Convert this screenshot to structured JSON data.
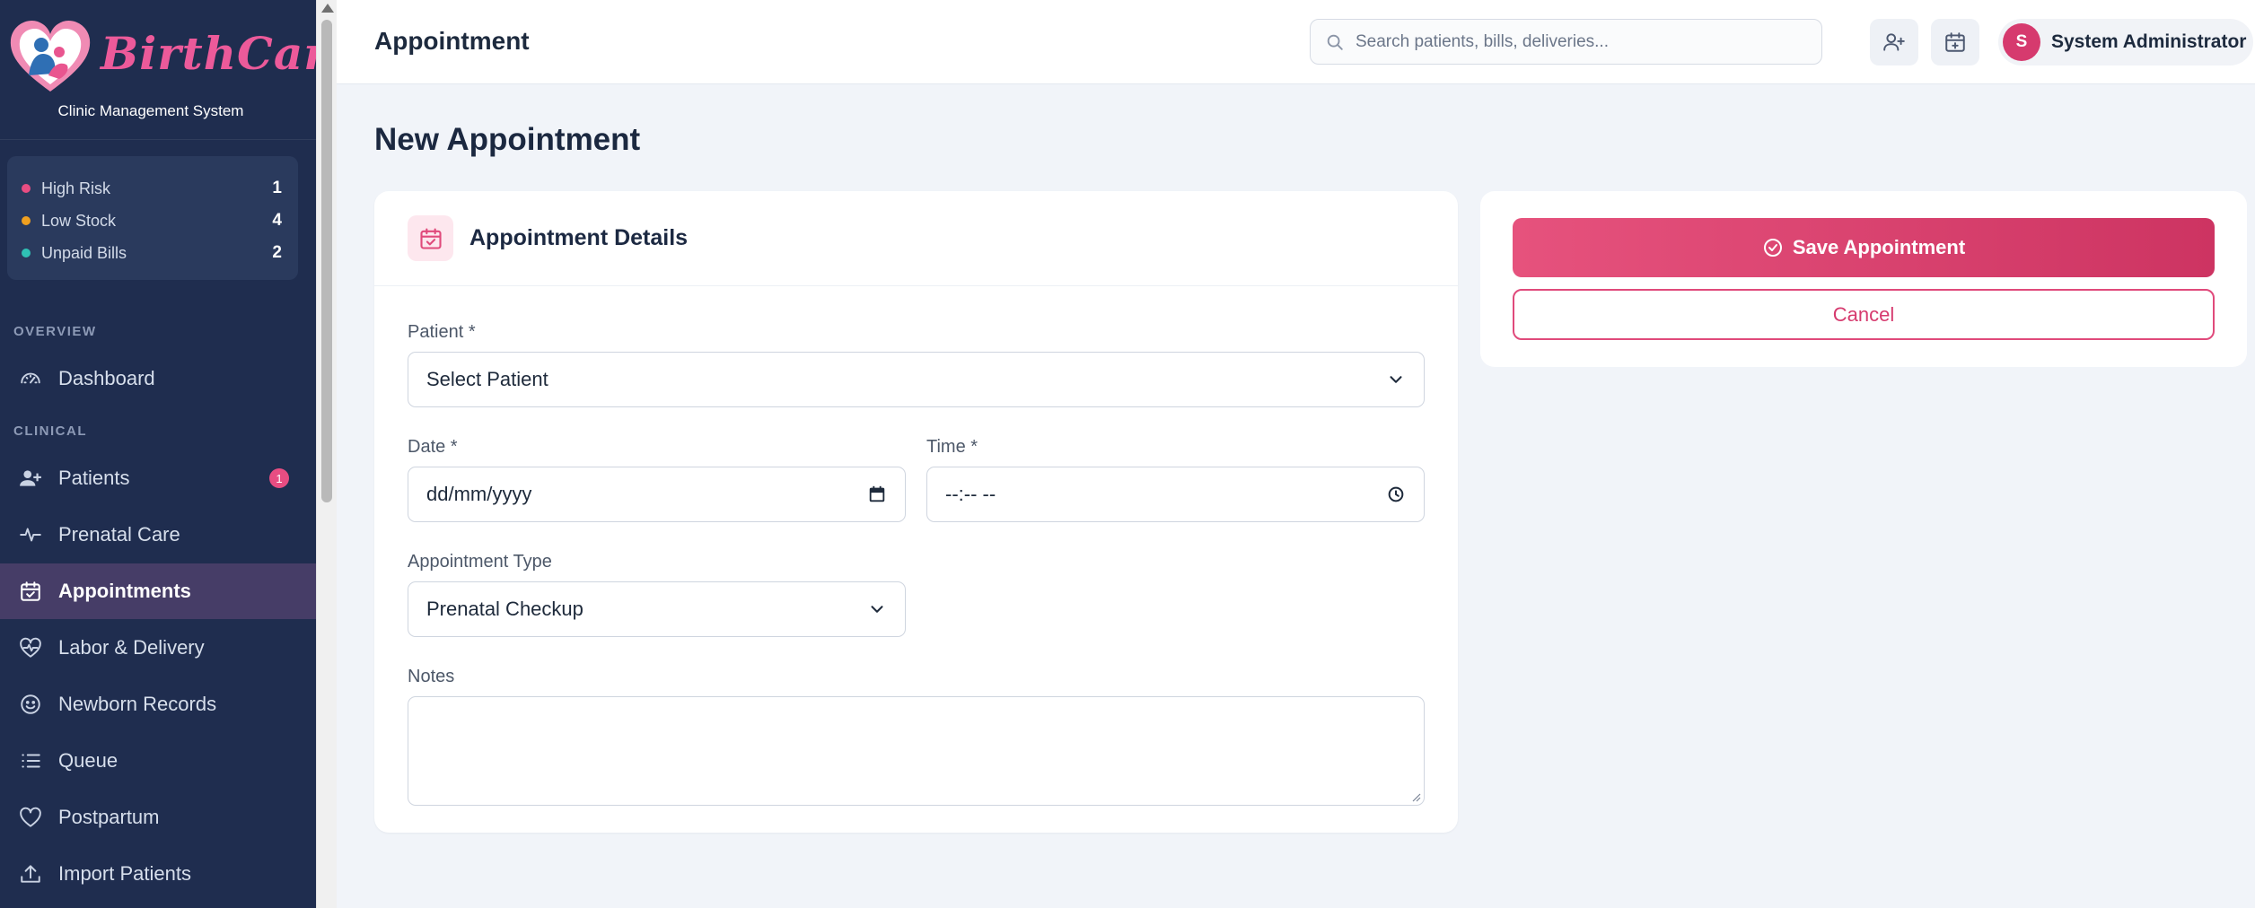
{
  "brand": {
    "name": "BirthCare",
    "subtitle": "Clinic Management System"
  },
  "stats": [
    {
      "label": "High Risk",
      "value": "1",
      "color": "#e84d82"
    },
    {
      "label": "Low Stock",
      "value": "4",
      "color": "#f0a020"
    },
    {
      "label": "Unpaid Bills",
      "value": "2",
      "color": "#2fc1b5"
    }
  ],
  "nav": {
    "overview_label": "OVERVIEW",
    "clinical_label": "CLINICAL",
    "items": [
      {
        "label": "Dashboard",
        "icon": "gauge-icon"
      },
      {
        "label": "Patients",
        "icon": "user-plus-icon",
        "badge": "1"
      },
      {
        "label": "Prenatal Care",
        "icon": "pulse-icon"
      },
      {
        "label": "Appointments",
        "icon": "calendar-check-icon",
        "active": true
      },
      {
        "label": "Labor & Delivery",
        "icon": "heart-pulse-icon"
      },
      {
        "label": "Newborn Records",
        "icon": "smile-icon"
      },
      {
        "label": "Queue",
        "icon": "list-icon"
      },
      {
        "label": "Postpartum",
        "icon": "heart-icon"
      },
      {
        "label": "Import Patients",
        "icon": "upload-icon"
      }
    ]
  },
  "topbar": {
    "title": "Appointment",
    "search_placeholder": "Search patients, bills, deliveries...",
    "user_initial": "S",
    "user_name": "System Administrator"
  },
  "page": {
    "title": "New Appointment"
  },
  "form": {
    "title": "Appointment Details",
    "patient_label": "Patient *",
    "patient_value": "Select Patient",
    "date_label": "Date *",
    "date_value": "dd/mm/yyyy",
    "time_label": "Time *",
    "time_value": "--:-- --",
    "type_label": "Appointment Type",
    "type_value": "Prenatal Checkup",
    "notes_label": "Notes"
  },
  "actions": {
    "save_label": "Save Appointment",
    "cancel_label": "Cancel"
  },
  "colors": {
    "accent": "#d63a6e",
    "sidebar": "#1f2d4f",
    "active_nav": "#463d67"
  }
}
